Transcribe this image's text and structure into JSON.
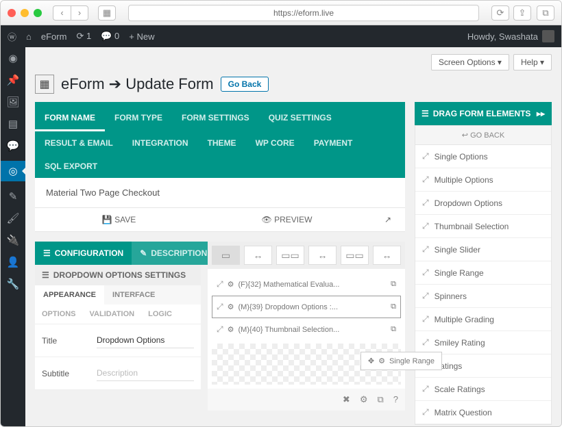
{
  "browser": {
    "url": "https://eform.live"
  },
  "wp": {
    "site": "eForm",
    "updates": "1",
    "comments": "0",
    "new": "New",
    "howdy": "Howdy, Swashata"
  },
  "page": {
    "title_prefix": "eForm",
    "title_action": "Update Form",
    "go_back": "Go Back",
    "screen_options": "Screen Options ▾",
    "help": "Help ▾"
  },
  "tabs": [
    "FORM NAME",
    "FORM TYPE",
    "FORM SETTINGS",
    "QUIZ SETTINGS",
    "RESULT & EMAIL",
    "INTEGRATION",
    "THEME",
    "WP CORE",
    "PAYMENT",
    "SQL EXPORT"
  ],
  "form_name": "Material Two Page Checkout",
  "actions": {
    "save": "SAVE",
    "preview": "PREVIEW"
  },
  "config": {
    "tab1": "CONFIGURATION",
    "tab2": "DESCRIPTION",
    "settings_header": "DROPDOWN OPTIONS SETTINGS",
    "subtabs": [
      "APPEARANCE",
      "INTERFACE"
    ],
    "subtabs2": [
      "OPTIONS",
      "VALIDATION",
      "LOGIC"
    ],
    "fields": {
      "title_label": "Title",
      "title_value": "Dropdown Options",
      "subtitle_label": "Subtitle",
      "subtitle_placeholder": "Description"
    }
  },
  "questions": [
    "(F){32} Mathematical Evalua...",
    "(M){39} Dropdown Options :...",
    "(M){40} Thumbnail Selection..."
  ],
  "dragging_label": "Single Range",
  "panel": {
    "header": "DRAG FORM ELEMENTS",
    "go_back": "GO BACK",
    "items": [
      "Single Options",
      "Multiple Options",
      "Dropdown Options",
      "Thumbnail Selection",
      "Single Slider",
      "Single Range",
      "Spinners",
      "Multiple Grading",
      "Smiley Rating",
      "Ratings",
      "Scale Ratings",
      "Matrix Question"
    ]
  }
}
